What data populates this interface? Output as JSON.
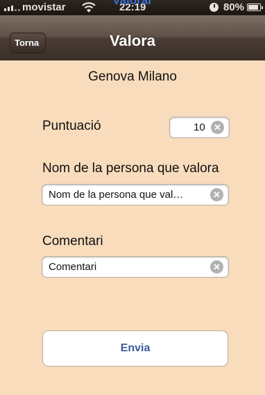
{
  "status_bar": {
    "carrier": "movistar",
    "time": "22:19",
    "battery": "80%"
  },
  "ghost_title": "Valorar",
  "nav": {
    "back_label": "Torna",
    "title": "Valora"
  },
  "item_name": "Genova Milano",
  "rating": {
    "label": "Puntuació",
    "value": "10"
  },
  "reviewer": {
    "label": "Nom de la persona que valora",
    "value": "Nom de la persona que val…"
  },
  "comment": {
    "label": "Comentari",
    "value": "Comentari"
  },
  "submit_label": "Envia",
  "icons": [
    "signal-icon",
    "wifi-icon",
    "alarm-icon",
    "battery-icon",
    "back-chevron",
    "clear-icon"
  ],
  "colors": {
    "background": "#f8dcbc",
    "nav_bar": "#5e4f47",
    "button_text": "#3a5aa0"
  }
}
